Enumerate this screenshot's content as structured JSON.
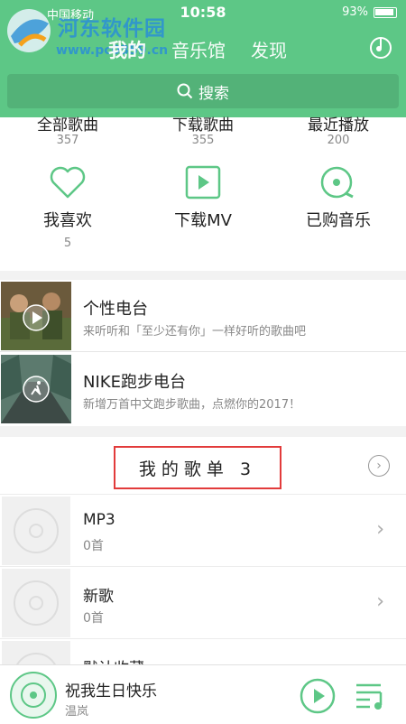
{
  "status": {
    "carrier": "中国移动",
    "time": "10:58",
    "battery": "93%"
  },
  "watermark": {
    "name": "河东软件园",
    "url": "www.pc0359.cn"
  },
  "tabs": [
    {
      "label": "我的",
      "active": true
    },
    {
      "label": "音乐馆",
      "active": false
    },
    {
      "label": "发现",
      "active": false
    }
  ],
  "search": {
    "placeholder": "搜索"
  },
  "stats": [
    {
      "label": "全部歌曲",
      "count": "357"
    },
    {
      "label": "下载歌曲",
      "count": "355"
    },
    {
      "label": "最近播放",
      "count": "200"
    }
  ],
  "quick": [
    {
      "label": "我喜欢",
      "count": "5",
      "icon": "heart-icon"
    },
    {
      "label": "下载MV",
      "count": "",
      "icon": "play-box-icon"
    },
    {
      "label": "已购音乐",
      "count": "",
      "icon": "disc-icon"
    }
  ],
  "radios": [
    {
      "title": "个性电台",
      "subtitle": "来听听和「至少还有你」一样好听的歌曲吧"
    },
    {
      "title": "NIKE跑步电台",
      "subtitle": "新增万首中文跑步歌曲，点燃你的2017！"
    }
  ],
  "playlists": {
    "header": "我的歌单 3",
    "items": [
      {
        "name": "MP3",
        "count": "0首"
      },
      {
        "name": "新歌",
        "count": "0首"
      },
      {
        "name": "默认收藏",
        "count": ""
      }
    ]
  },
  "now_playing": {
    "song": "祝我生日快乐",
    "artist": "温岚"
  },
  "colors": {
    "accent": "#5dc786",
    "highlight_box": "#e23b3b"
  }
}
